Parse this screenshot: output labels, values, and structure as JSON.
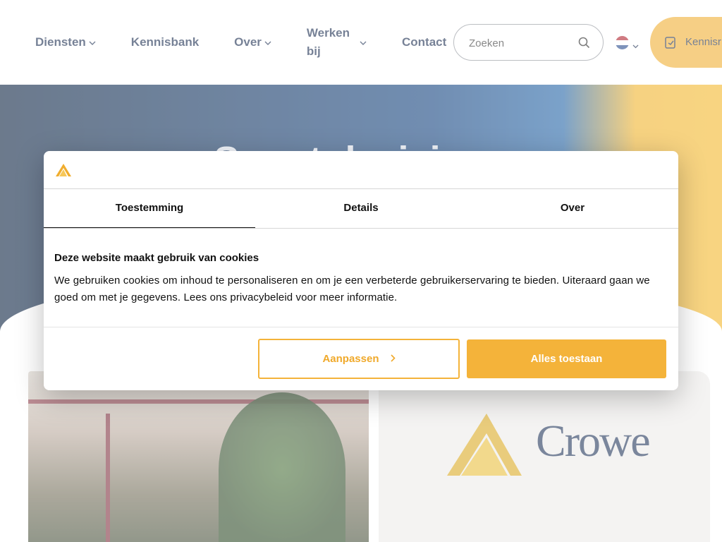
{
  "header": {
    "nav": [
      {
        "label": "Diensten",
        "has_dropdown": true
      },
      {
        "label": "Kennisbank",
        "has_dropdown": false
      },
      {
        "label": "Over",
        "has_dropdown": true
      },
      {
        "label_line1": "Werken",
        "label_line2": "bij",
        "has_dropdown": true
      },
      {
        "label": "Contact",
        "has_dropdown": false
      }
    ],
    "search": {
      "placeholder": "Zoeken",
      "icon": "search-icon"
    },
    "language": {
      "flag": "nl",
      "icon": "chevron-down-icon"
    },
    "cta": {
      "label": "Kennisr",
      "icon": "document-icon",
      "color": "#f0ad2e"
    }
  },
  "hero": {
    "title": "Smart decisions"
  },
  "brand": {
    "name": "Crowe",
    "accent": "#f4b33a",
    "navy": "#14264a"
  },
  "cookie_dialog": {
    "tabs": [
      {
        "label": "Toestemming",
        "active": true
      },
      {
        "label": "Details",
        "active": false
      },
      {
        "label": "Over",
        "active": false
      }
    ],
    "heading": "Deze website maakt gebruik van cookies",
    "body": "We gebruiken cookies om inhoud te personaliseren en om je een verbeterde gebruikerservaring te bieden. Uiteraard gaan we goed om met je gegevens. Lees ons privacybeleid voor meer informatie.",
    "buttons": {
      "customize": "Aanpassen",
      "allow_all": "Alles toestaan"
    }
  }
}
